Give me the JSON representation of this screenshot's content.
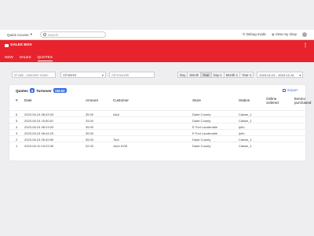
{
  "topbar": {
    "quick_access": "Quick Access",
    "search_placeholder": "Search",
    "debug_mode": "Debug mode",
    "view_shop": "View my shop"
  },
  "header": {
    "brand": "SALES BOX",
    "menu_icon": "⋮"
  },
  "tabs": [
    {
      "label": "NEW"
    },
    {
      "label": "SALES"
    },
    {
      "label": "QUOTES",
      "active": true
    }
  ],
  "filters": {
    "search_placeholder": "Id sale, customer name",
    "stores_value": "All stores",
    "amounts_placeholder": "All Amounts",
    "periods": [
      "Day",
      "Month",
      "Year",
      "Day-1",
      "Month-1",
      "Year-1"
    ],
    "active_period": "Year",
    "date_range": "2023-01-01 - 2023-12-31"
  },
  "summary": {
    "quotes_label": "Quotes",
    "quotes_count": "6",
    "turnover_label": "Turnover",
    "turnover_value": "196.50"
  },
  "export_label": "Export",
  "table": {
    "headers": [
      "#",
      "Date",
      "Amount",
      "Customer",
      "Store",
      "Station",
      "Online ordered",
      "Itemno purchased"
    ],
    "rows": [
      [
        "6",
        "2023-05-24 08:43:03",
        "35.90",
        "AAA",
        "Dade County",
        "Caisse_1",
        "",
        ""
      ],
      [
        "5",
        "2023-05-24 15:50:01",
        "29.00",
        "",
        "Dade County",
        "Caisse_1",
        "",
        ""
      ],
      [
        "4",
        "2023-05-24 08:23:03",
        "35.90",
        "",
        "E Fort Lauderdale",
        "Ipifo",
        "",
        ""
      ],
      [
        "3",
        "2023-05-24 08:44:29",
        "35.90",
        "",
        "E Fort Lauderdale",
        "Ipifo",
        "",
        ""
      ],
      [
        "2",
        "2023-05-24 05:49:50",
        "35.00",
        "Toot",
        "Dade County",
        "Caisse_1",
        "",
        ""
      ],
      [
        "1",
        "2023-05-10 15:23:30",
        "22.00",
        "John DOE",
        "Dade County",
        "Caisse_1",
        "",
        ""
      ]
    ]
  },
  "colors": {
    "brand_red": "#e8232d",
    "accent_blue": "#3b6ee0"
  }
}
